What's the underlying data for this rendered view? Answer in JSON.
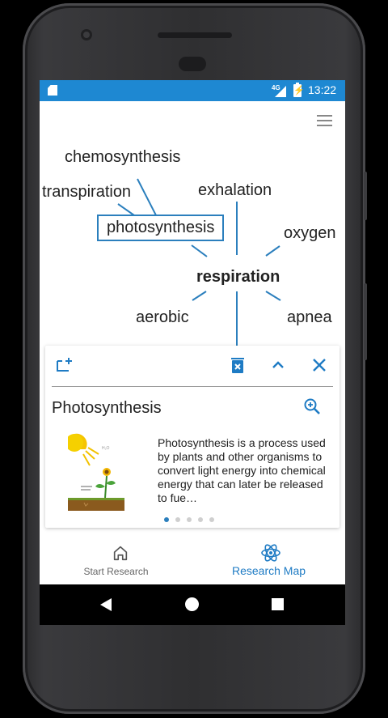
{
  "status_bar": {
    "network": "4G",
    "time": "13:22"
  },
  "map": {
    "center": "respiration",
    "selected": "photosynthesis",
    "words": {
      "chemosynthesis": "chemosynthesis",
      "transpiration": "transpiration",
      "exhalation": "exhalation",
      "photosynthesis": "photosynthesis",
      "oxygen": "oxygen",
      "respiration": "respiration",
      "aerobic": "aerobic",
      "apnea": "apnea"
    }
  },
  "card": {
    "title": "Photosynthesis",
    "description": "Photosynthesis is a process used by plants and other organisms to convert light energy into chemical energy that can later be released to fue…",
    "page_index": 0,
    "page_count": 5,
    "toolbar_icons": [
      "add-tab-icon",
      "delete-icon",
      "chevron-up-icon",
      "close-icon"
    ],
    "accent": "#1e7bc4"
  },
  "bottom_nav": {
    "items": [
      {
        "label": "Start Research",
        "icon": "home-icon",
        "active": false
      },
      {
        "label": "Research Map",
        "icon": "atom-icon",
        "active": true
      }
    ]
  },
  "colors": {
    "status_bar": "#1e88d2",
    "accent": "#2b7fbd"
  }
}
